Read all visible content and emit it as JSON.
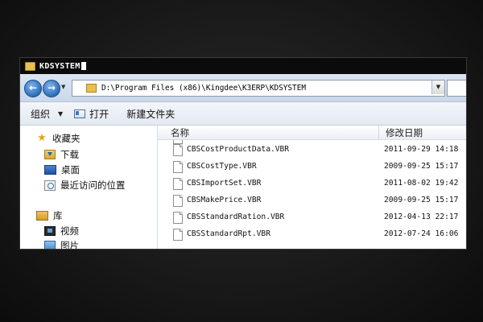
{
  "window": {
    "title": "KDSYSTEM"
  },
  "navbar": {
    "address": "D:\\Program Files (x86)\\Kingdee\\K3ERP\\KDSYSTEM"
  },
  "toolbar": {
    "organize_label": "组织",
    "open_label": "打开",
    "new_folder_label": "新建文件夹"
  },
  "navpane": {
    "favorites_label": "收藏夹",
    "downloads_label": "下载",
    "desktop_label": "桌面",
    "recent_label": "最近访问的位置",
    "libraries_label": "库",
    "videos_label": "视频",
    "pictures_label": "图片"
  },
  "columns": {
    "name": "名称",
    "date": "修改日期"
  },
  "files": [
    {
      "name": "CBSCostProductData.VBR",
      "date": "2011-09-29 14:18"
    },
    {
      "name": "CBSCostType.VBR",
      "date": "2009-09-25 15:17"
    },
    {
      "name": "CBSImportSet.VBR",
      "date": "2011-08-02 19:42"
    },
    {
      "name": "CBSMakePrice.VBR",
      "date": "2009-09-25 15:17"
    },
    {
      "name": "CBSStandardRation.VBR",
      "date": "2012-04-13 22:17"
    },
    {
      "name": "CBSStandardRpt.VBR",
      "date": "2012-07-24 16:06"
    }
  ]
}
